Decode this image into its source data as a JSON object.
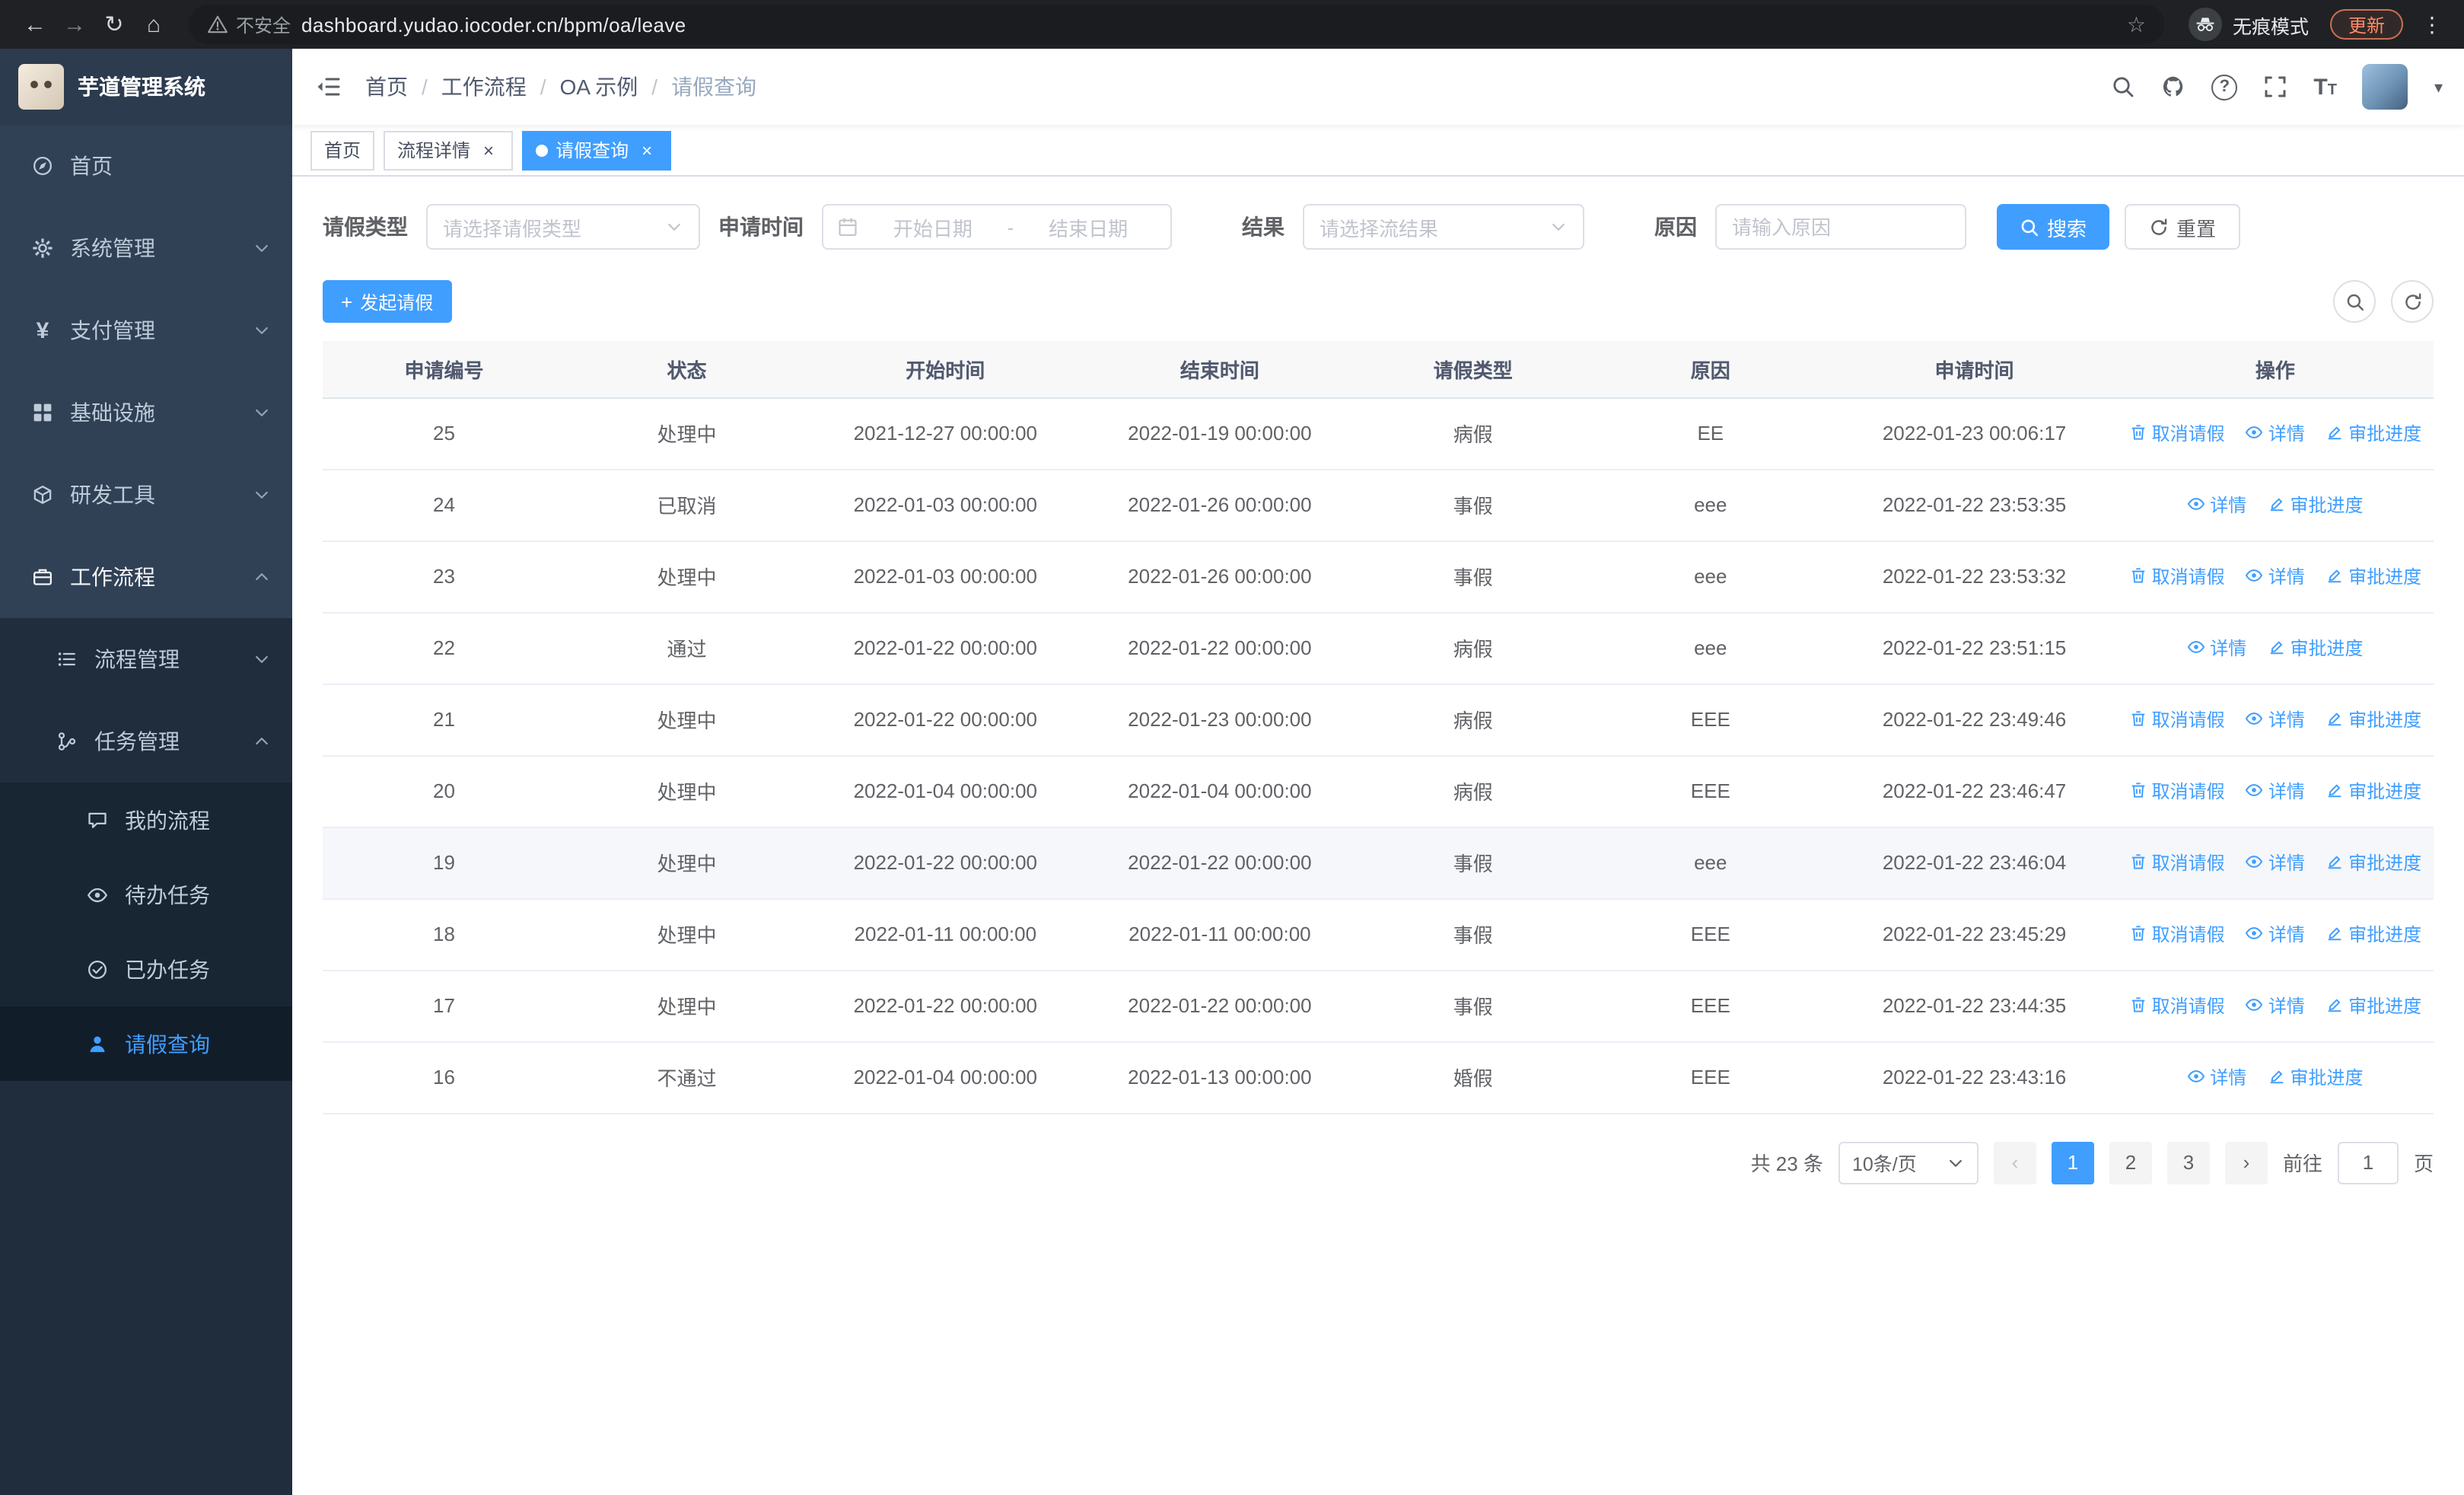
{
  "colors": {
    "primary": "#409EFF",
    "sidebar_bg": "#304156",
    "sidebar_sub_bg": "#1F2D3D",
    "update_accent": "#FF8A65"
  },
  "icons": {
    "back": "←",
    "forward": "→",
    "reload": "↻",
    "home": "⌂",
    "star": "☆",
    "menu_dots": "⋮",
    "caret_down": "▾",
    "yen": "¥",
    "plus": "+",
    "close": "×",
    "help_glyph": "?",
    "font_large": "T",
    "font_small": "T",
    "pager_prev": "‹",
    "pager_next": "›",
    "breadcrumb_separator": "/",
    "date_separator": "-"
  },
  "browser": {
    "security_label": "不安全",
    "url": "dashboard.yudao.iocoder.cn/bpm/oa/leave",
    "incognito_label": "无痕模式",
    "update_label": "更新"
  },
  "sidebar": {
    "app_title": "芋道管理系统",
    "menu": [
      {
        "label": "首页"
      },
      {
        "label": "系统管理"
      },
      {
        "label": "支付管理"
      },
      {
        "label": "基础设施"
      },
      {
        "label": "研发工具"
      },
      {
        "label": "工作流程"
      },
      {
        "label": "流程管理"
      },
      {
        "label": "任务管理"
      },
      {
        "label": "我的流程"
      },
      {
        "label": "待办任务"
      },
      {
        "label": "已办任务"
      },
      {
        "label": "请假查询"
      }
    ]
  },
  "breadcrumb": [
    "首页",
    "工作流程",
    "OA 示例",
    "请假查询"
  ],
  "tabs": [
    {
      "label": "首页"
    },
    {
      "label": "流程详情"
    },
    {
      "label": "请假查询"
    }
  ],
  "filters": {
    "leave_type_label": "请假类型",
    "leave_type_placeholder": "请选择请假类型",
    "apply_time_label": "申请时间",
    "start_placeholder": "开始日期",
    "end_placeholder": "结束日期",
    "result_label": "结果",
    "result_placeholder": "请选择流结果",
    "reason_label": "原因",
    "reason_placeholder": "请输入原因",
    "search_label": "搜索",
    "reset_label": "重置"
  },
  "toolbar": {
    "create_label": "发起请假"
  },
  "table": {
    "columns": [
      "申请编号",
      "状态",
      "开始时间",
      "结束时间",
      "请假类型",
      "原因",
      "申请时间",
      "操作"
    ],
    "action_labels": {
      "cancel": "取消请假",
      "detail": "详情",
      "progress": "审批进度"
    },
    "rows": [
      {
        "id": "25",
        "status": "处理中",
        "start_time": "2021-12-27 00:00:00",
        "end_time": "2022-01-19 00:00:00",
        "leave_type": "病假",
        "reason": "EE",
        "apply_time": "2022-01-23 00:06:17",
        "cancellable": true,
        "hover": false
      },
      {
        "id": "24",
        "status": "已取消",
        "start_time": "2022-01-03 00:00:00",
        "end_time": "2022-01-26 00:00:00",
        "leave_type": "事假",
        "reason": "eee",
        "apply_time": "2022-01-22 23:53:35",
        "cancellable": false,
        "hover": false
      },
      {
        "id": "23",
        "status": "处理中",
        "start_time": "2022-01-03 00:00:00",
        "end_time": "2022-01-26 00:00:00",
        "leave_type": "事假",
        "reason": "eee",
        "apply_time": "2022-01-22 23:53:32",
        "cancellable": true,
        "hover": false
      },
      {
        "id": "22",
        "status": "通过",
        "start_time": "2022-01-22 00:00:00",
        "end_time": "2022-01-22 00:00:00",
        "leave_type": "病假",
        "reason": "eee",
        "apply_time": "2022-01-22 23:51:15",
        "cancellable": false,
        "hover": false
      },
      {
        "id": "21",
        "status": "处理中",
        "start_time": "2022-01-22 00:00:00",
        "end_time": "2022-01-23 00:00:00",
        "leave_type": "病假",
        "reason": "EEE",
        "apply_time": "2022-01-22 23:49:46",
        "cancellable": true,
        "hover": false
      },
      {
        "id": "20",
        "status": "处理中",
        "start_time": "2022-01-04 00:00:00",
        "end_time": "2022-01-04 00:00:00",
        "leave_type": "病假",
        "reason": "EEE",
        "apply_time": "2022-01-22 23:46:47",
        "cancellable": true,
        "hover": false
      },
      {
        "id": "19",
        "status": "处理中",
        "start_time": "2022-01-22 00:00:00",
        "end_time": "2022-01-22 00:00:00",
        "leave_type": "事假",
        "reason": "eee",
        "apply_time": "2022-01-22 23:46:04",
        "cancellable": true,
        "hover": true
      },
      {
        "id": "18",
        "status": "处理中",
        "start_time": "2022-01-11 00:00:00",
        "end_time": "2022-01-11 00:00:00",
        "leave_type": "事假",
        "reason": "EEE",
        "apply_time": "2022-01-22 23:45:29",
        "cancellable": true,
        "hover": false
      },
      {
        "id": "17",
        "status": "处理中",
        "start_time": "2022-01-22 00:00:00",
        "end_time": "2022-01-22 00:00:00",
        "leave_type": "事假",
        "reason": "EEE",
        "apply_time": "2022-01-22 23:44:35",
        "cancellable": true,
        "hover": false
      },
      {
        "id": "16",
        "status": "不通过",
        "start_time": "2022-01-04 00:00:00",
        "end_time": "2022-01-13 00:00:00",
        "leave_type": "婚假",
        "reason": "EEE",
        "apply_time": "2022-01-22 23:43:16",
        "cancellable": false,
        "hover": false
      }
    ]
  },
  "pagination": {
    "total_label": "共 23 条",
    "page_size_label": "10条/页",
    "pages": [
      "1",
      "2",
      "3"
    ],
    "active_page": "1",
    "goto_label": "前往",
    "goto_value": "1",
    "goto_unit": "页"
  }
}
